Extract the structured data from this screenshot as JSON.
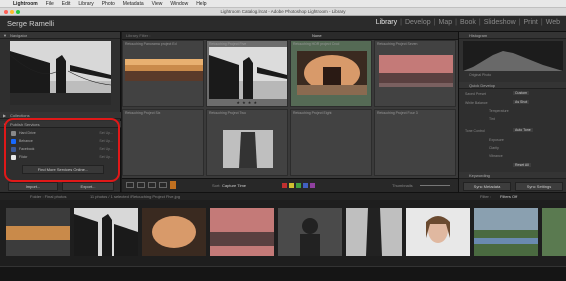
{
  "menubar": {
    "app": "Lightroom",
    "items": [
      "File",
      "Edit",
      "Library",
      "Photo",
      "Metadata",
      "View",
      "Window",
      "Help"
    ]
  },
  "window": {
    "title": "Lightroom Catalog.lrcat - Adobe Photoshop Lightroom - Library"
  },
  "identity": {
    "name": "Serge Ramelli"
  },
  "modules": [
    "Library",
    "Develop",
    "Map",
    "Book",
    "Slideshow",
    "Print",
    "Web"
  ],
  "left_panel": {
    "navigator": "Navigator",
    "collections": "Collections",
    "publish_services": "Publish Services",
    "services": [
      {
        "label": "Hard Drive",
        "action": "Set Up..."
      },
      {
        "label": "Behance",
        "action": "Set Up..."
      },
      {
        "label": "Facebook",
        "action": "Set Up..."
      },
      {
        "label": "Flickr",
        "action": "Set Up..."
      }
    ],
    "find_more": "Find More Services Online...",
    "import_label": "Import...",
    "export_label": "Export..."
  },
  "grid": {
    "header": "Library Filter :",
    "filter_none": "None",
    "cells": [
      {
        "name": "Retouching Panorama project Ed"
      },
      {
        "name": "Retouching Project Five"
      },
      {
        "name": "Retouching HDR project Crod"
      },
      {
        "name": "Retouching Project Seven"
      },
      {
        "name": "Retouching Project Six"
      },
      {
        "name": "Retouching Project Two"
      },
      {
        "name": "Retouching Project Eight"
      },
      {
        "name": "Retouching Project Four 3"
      }
    ],
    "stars": "★ ★ ★ ★"
  },
  "toolbar": {
    "sort_label": "Sort:",
    "sort_value": "Capture Time",
    "thumbnails_label": "Thumbnails"
  },
  "right_panel": {
    "histogram": "Histogram",
    "original_photo": "Original Photo",
    "quick_develop": "Quick Develop",
    "saved_preset": "Saved Preset",
    "saved_preset_value": "Custom",
    "white_balance": "White Balance",
    "white_balance_value": "As Shot",
    "temperature": "Temperature",
    "tint": "Tint",
    "tone_control": "Tone Control",
    "auto_tone": "Auto Tone",
    "exposure": "Exposure",
    "clarity": "Clarity",
    "vibrance": "Vibrance",
    "reset_all": "Reset All",
    "keywording": "Keywording",
    "sync_metadata": "Sync Metadata",
    "sync_settings": "Sync Settings"
  },
  "filmstrip": {
    "source_label": "Folder : Final photos",
    "count_label": "11 photos / 1 selected /Retouching Project Five.jpg",
    "filter_label": "Filter :",
    "filter_value": "Filters Off"
  },
  "colors": {
    "highlight": "#e01818",
    "active_module": "#e8e8e8",
    "inactive_module": "#8a8a8a"
  }
}
